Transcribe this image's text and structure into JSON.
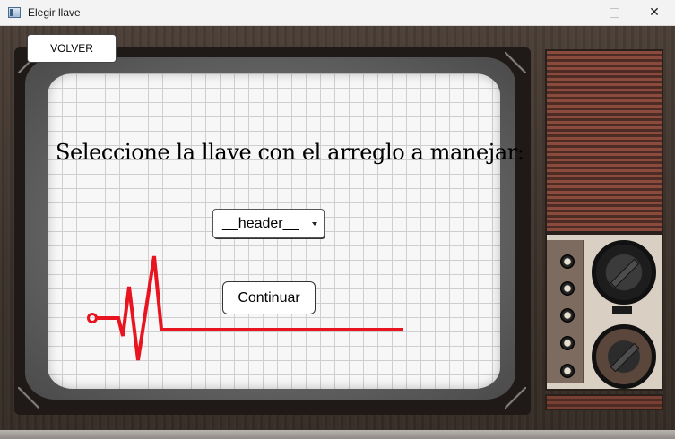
{
  "window": {
    "title": "Elegir llave",
    "controls": [
      "minimize",
      "maximize",
      "close"
    ]
  },
  "toolbar": {
    "back_label": "VOLVER"
  },
  "main": {
    "prompt": "Seleccione la llave con el arreglo a manejar:",
    "key_select": {
      "selected": "__header__"
    },
    "continue_label": "Continuar"
  },
  "colors": {
    "ecg_line": "#e8141f",
    "screen_bg": "#f7f7f7",
    "wood": "#3b302a"
  },
  "icons": {
    "app": "window-app-icon",
    "minimize": "minimize-icon",
    "maximize": "maximize-icon",
    "close": "close-icon",
    "select": "chevron-down-icon",
    "decoration": "heartbeat-line-icon"
  }
}
